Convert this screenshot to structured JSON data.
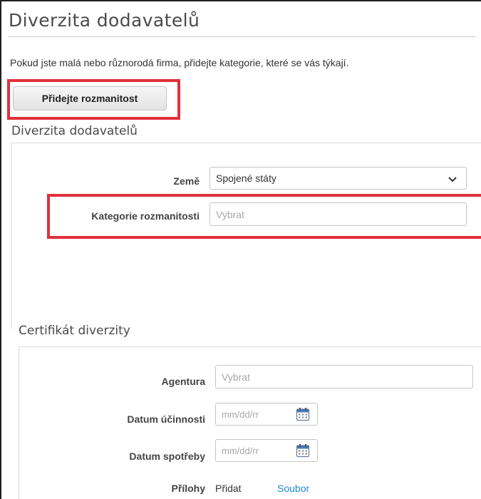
{
  "page": {
    "title": "Diverzita dodavatelů",
    "intro": "Pokud jste malá nebo různorodá firma, přidejte kategorie, které se vás týkají.",
    "add_diversity_label": "Přidejte rozmanitost"
  },
  "diversity_section": {
    "title": "Diverzita dodavatelů",
    "country_label": "Země",
    "country_value": "Spojené státy",
    "category_label": "Kategorie rozmanitosti",
    "category_placeholder": "Vybrat"
  },
  "certificate_section": {
    "title": "Certifikát diverzity",
    "agency_label": "Agentura",
    "agency_placeholder": "Vybrat",
    "effective_date_label": "Datum účinnosti",
    "effective_date_placeholder": "mm/dd/rr",
    "expiry_date_label": "Datum spotřeby",
    "expiry_date_placeholder": "mm/dd/rr",
    "attachments_label": "Přílohy",
    "add_label": "Přidat",
    "file_label": "Soubor"
  },
  "icons": {
    "dropdown": "chevron-down-icon",
    "calendar": "calendar-icon"
  },
  "colors": {
    "highlight": "#e0303c",
    "link": "#1a8ad4",
    "border": "#c4c4c4"
  }
}
